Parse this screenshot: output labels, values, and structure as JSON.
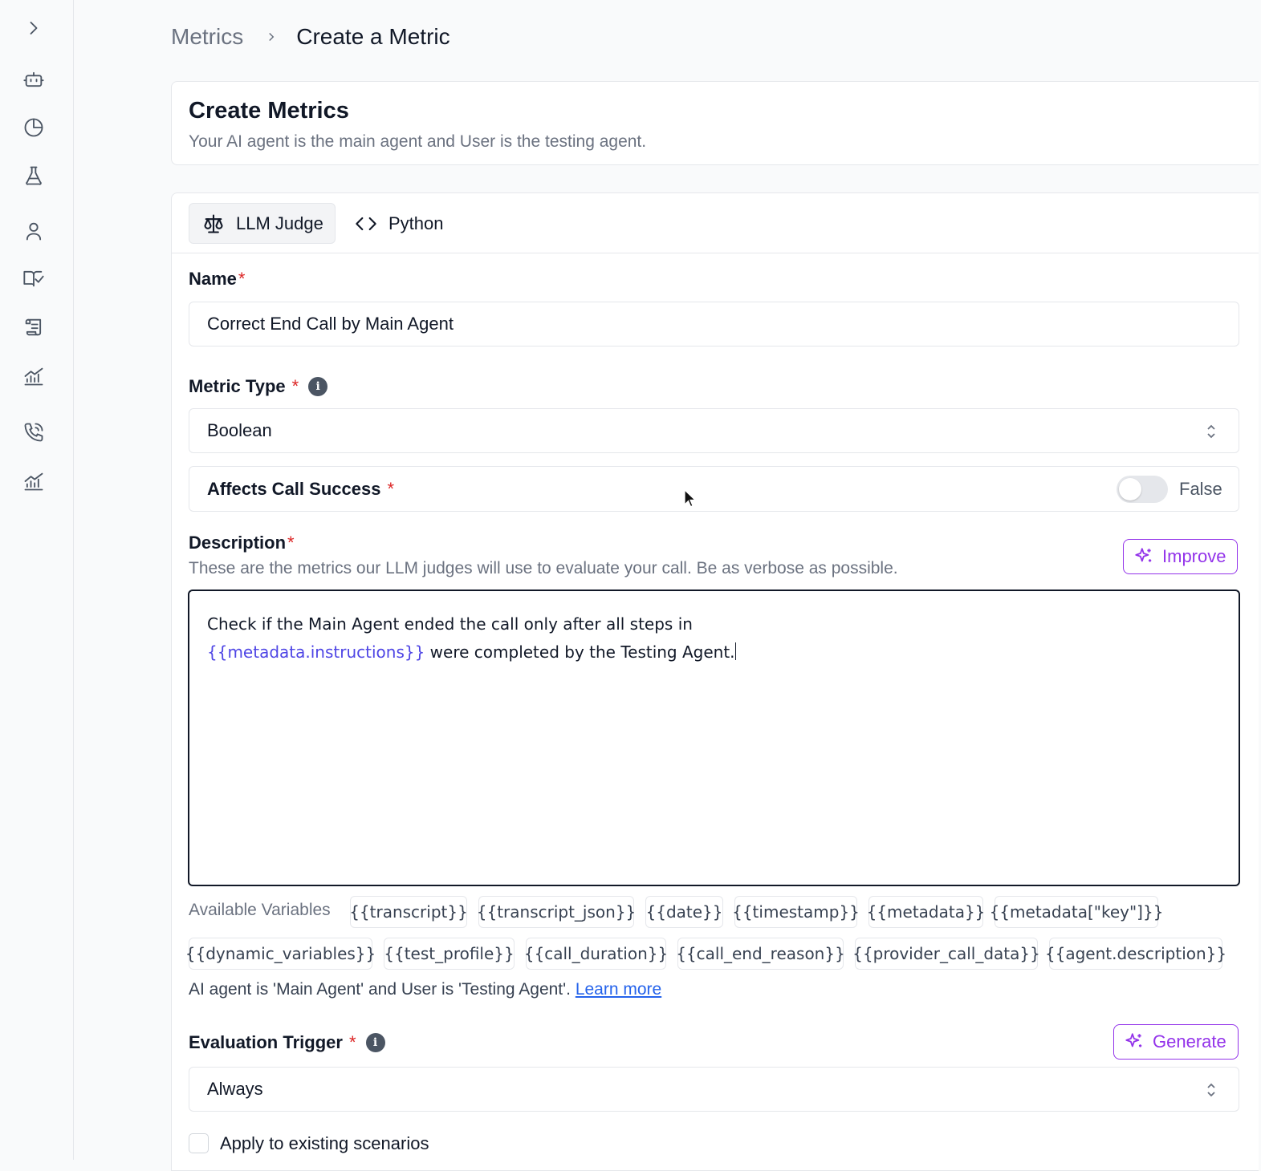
{
  "sidebar": {
    "icons": [
      "chevron-right-icon",
      "bot-icon",
      "pie-chart-icon",
      "flask-icon",
      "user-icon",
      "book-check-icon",
      "scroll-icon",
      "chart-icon",
      "phone-icon",
      "chart-icon"
    ]
  },
  "breadcrumb": {
    "parent": "Metrics",
    "current": "Create a Metric"
  },
  "header": {
    "title": "Create Metrics",
    "subtitle": "Your AI agent is the main agent and User is the testing agent."
  },
  "tabs": [
    {
      "label": "LLM Judge",
      "icon": "scale-icon",
      "active": true
    },
    {
      "label": "Python",
      "icon": "code-icon",
      "active": false
    }
  ],
  "form": {
    "name_label": "Name",
    "name_value": "Correct End Call by Main Agent",
    "metric_type_label": "Metric Type",
    "metric_type_value": "Boolean",
    "affects_label": "Affects Call Success",
    "affects_value": "False",
    "description_label": "Description",
    "description_help": "These are the metrics our LLM judges will use to evaluate your call. Be as verbose as possible.",
    "improve_label": "Improve",
    "description_line1": "Check if the Main Agent ended the call only after all steps in",
    "description_var": "{{metadata.instructions}}",
    "description_line2": " were completed by the Testing Agent.",
    "available_vars_label": "Available Variables",
    "variables": [
      "{{transcript}}",
      "{{transcript_json}}",
      "{{date}}",
      "{{timestamp}}",
      "{{metadata}}",
      "{{metadata[\"key\"]}}",
      "{{dynamic_variables}}",
      "{{test_profile}}",
      "{{call_duration}}",
      "{{call_end_reason}}",
      "{{provider_call_data}}",
      "{{agent.description}}"
    ],
    "note_text": "AI agent is 'Main Agent' and User is 'Testing Agent'. ",
    "learn_more": "Learn more",
    "trigger_label": "Evaluation Trigger",
    "generate_label": "Generate",
    "trigger_value": "Always",
    "apply_label": "Apply to existing scenarios"
  },
  "colors": {
    "accent": "#9333ea",
    "required": "#dc2626",
    "variable": "#4f46e5",
    "link": "#2563eb"
  }
}
